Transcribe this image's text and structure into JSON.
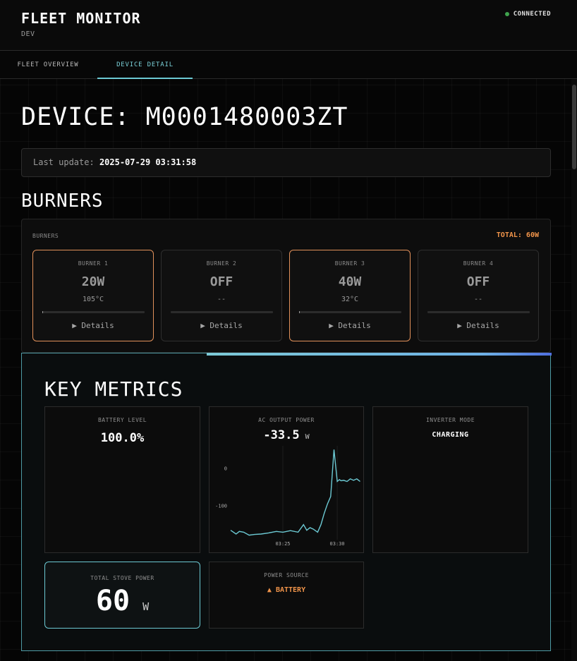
{
  "header": {
    "app_title": "FLEET MONITOR",
    "environment": "DEV",
    "connection_status": "CONNECTED",
    "connection_color": "#3fa34d"
  },
  "tabs": [
    {
      "label": "FLEET OVERVIEW",
      "active": false
    },
    {
      "label": "DEVICE DETAIL",
      "active": true
    }
  ],
  "device": {
    "title": "DEVICE: M0001480003ZT",
    "last_update_label": "Last update:",
    "last_update_value": "2025-07-29 03:31:58"
  },
  "burners": {
    "section_title": "BURNERS",
    "panel_label": "BURNERS",
    "total_label": "TOTAL: 60W",
    "accent_color": "#e0905a",
    "items": [
      {
        "name": "BURNER 1",
        "power": "20W",
        "temp": "105°C",
        "on": true,
        "level": 0.01,
        "details": "▶ Details"
      },
      {
        "name": "BURNER 2",
        "power": "OFF",
        "temp": "--",
        "on": false,
        "level": 0,
        "details": "▶ Details"
      },
      {
        "name": "BURNER 3",
        "power": "40W",
        "temp": "32°C",
        "on": true,
        "level": 0.01,
        "details": "▶ Details"
      },
      {
        "name": "BURNER 4",
        "power": "OFF",
        "temp": "--",
        "on": false,
        "level": 0,
        "details": "▶ Details"
      }
    ]
  },
  "metrics": {
    "section_title": "KEY METRICS",
    "battery": {
      "label": "BATTERY LEVEL",
      "value": "100.0%"
    },
    "ac_output": {
      "label": "AC OUTPUT POWER",
      "value": "-33.5",
      "unit": "W"
    },
    "inverter": {
      "label": "INVERTER MODE",
      "value": "CHARGING"
    },
    "stove": {
      "label": "TOTAL STOVE POWER",
      "value": "60",
      "unit": "W"
    },
    "power_source": {
      "label": "POWER SOURCE",
      "value": "▲ BATTERY",
      "color": "#f0944a"
    }
  },
  "chart_data": {
    "type": "line",
    "title": "AC OUTPUT POWER",
    "xlabel": "",
    "ylabel": "",
    "x_ticks": [
      "03:25",
      "03:30"
    ],
    "y_ticks": [
      0,
      -100
    ],
    "ylim": [
      -190,
      60
    ],
    "xlim": [
      -9.8,
      2.2
    ],
    "line_color": "#6cc9d3",
    "grid": false,
    "series": [
      {
        "name": "",
        "x": [
          -9.8,
          -9.3,
          -9.0,
          -8.6,
          -8.1,
          -7.6,
          -7.0,
          -6.3,
          -5.6,
          -5.0,
          -4.3,
          -3.6,
          -3.1,
          -2.8,
          -2.5,
          -2.2,
          -1.8,
          -1.5,
          -1.2,
          -0.9,
          -0.6,
          -0.3,
          0.0,
          0.2,
          0.35,
          0.6,
          0.9,
          1.2,
          1.5,
          1.8,
          2.1
        ],
        "y": [
          -165,
          -175,
          -168,
          -170,
          -178,
          -176,
          -175,
          -172,
          -168,
          -170,
          -166,
          -170,
          -150,
          -165,
          -158,
          -162,
          -170,
          -150,
          -120,
          -95,
          -75,
          50,
          -35,
          -30,
          -33,
          -32,
          -35,
          -28,
          -32,
          -28,
          -35
        ]
      }
    ]
  }
}
